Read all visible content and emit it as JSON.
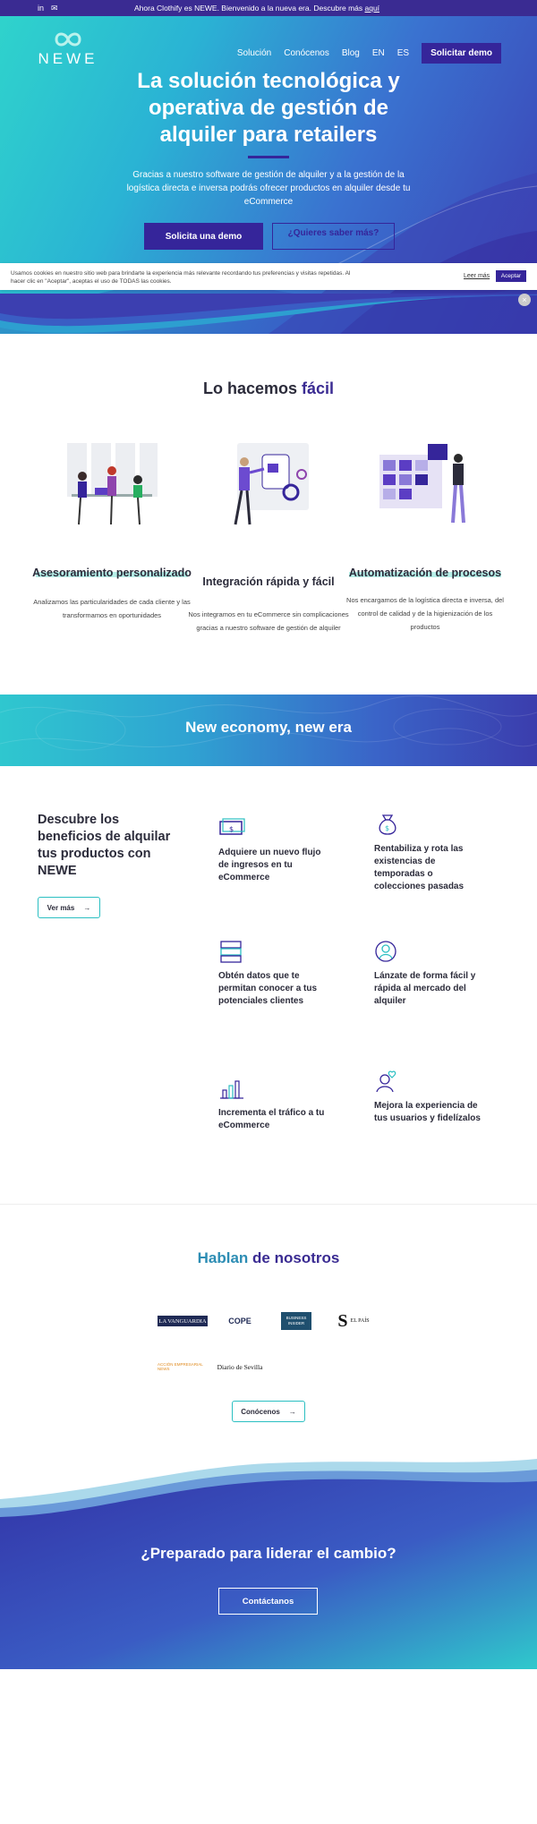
{
  "topbar": {
    "social": [
      {
        "icon": "linkedin-icon",
        "glyph": "in"
      },
      {
        "icon": "email-icon",
        "glyph": "✉"
      }
    ],
    "promo_text": "Ahora Clothify es NEWE. Bienvenido a la nueva era. Descubre más ",
    "promo_link": "aquí"
  },
  "header": {
    "logo_text": "NEWE",
    "nav": [
      "Solución",
      "Conócenos",
      "Blog",
      "EN",
      "ES"
    ],
    "cta": "Solicitar demo"
  },
  "hero": {
    "title": "La solución tecnológica y operativa de gestión de alquiler para retailers",
    "subtitle": "Gracias a nuestro software de gestión de alquiler y a la gestión de la logística directa e inversa podrás ofrecer productos en alquiler desde tu eCommerce",
    "primary_button": "Solicita una demo",
    "secondary_button": "¿Quieres saber más?"
  },
  "cookie": {
    "text": "Usamos cookies en nuestro sitio web para brindarte la experiencia más relevante recordando tus preferencias y visitas repetidas. Al hacer clic en \"Aceptar\", aceptas el uso de TODAS las cookies.",
    "read_more": "Leer más",
    "accept": "Aceptar",
    "close": "×"
  },
  "easy": {
    "title_plain": "Lo hacemos ",
    "title_accent": "fácil",
    "features": [
      {
        "title": "Asesoramiento personalizado",
        "text": "Analizamos las particularidades de cada cliente y las transformamos en oportunidades"
      },
      {
        "title": "Integración rápida y fácil",
        "text": "Nos integramos en tu eCommerce sin complicaciones gracias a nuestro software de gestión de alquiler"
      },
      {
        "title": "Automatización de procesos",
        "text": "Nos encargamos de la logística directa e inversa, del control de calidad y de la higienización de los productos"
      }
    ]
  },
  "banner": {
    "title": "New economy, new era"
  },
  "benefits": {
    "title": "Descubre los beneficios de alquilar tus productos con NEWE",
    "button": "Ver más",
    "items": [
      {
        "icon": "money-icon",
        "label": "Adquiere un nuevo flujo de ingresos en tu eCommerce"
      },
      {
        "icon": "money-bag-icon",
        "label": "Rentabiliza y rota las existencias de temporadas o colecciones pasadas"
      },
      {
        "icon": "database-icon",
        "label": "Obtén datos que te permitan conocer a tus potenciales clientes"
      },
      {
        "icon": "user-circle-icon",
        "label": "Lánzate de forma fácil y rápida al mercado del alquiler"
      },
      {
        "icon": "bar-chart-icon",
        "label": "Incrementa el tráfico a tu eCommerce"
      },
      {
        "icon": "user-heart-icon",
        "label": "Mejora la experiencia de tus usuarios y fidelízalos"
      }
    ]
  },
  "press": {
    "title_plain": "Hablan ",
    "title_accent": "de nosotros",
    "logos": [
      "LA VANGUARDIA",
      "COPE",
      "BUSINESS INSIDER",
      "EL PAÍS",
      "ACCIÓN EMPRESARIAL NEWS",
      "Diario de Sevilla"
    ],
    "button": "Conócenos"
  },
  "cta": {
    "title": "¿Preparado para liderar el cambio?",
    "button": "Contáctanos"
  },
  "colors": {
    "brand_purple": "#35259a",
    "brand_teal": "#2fd3cc"
  }
}
